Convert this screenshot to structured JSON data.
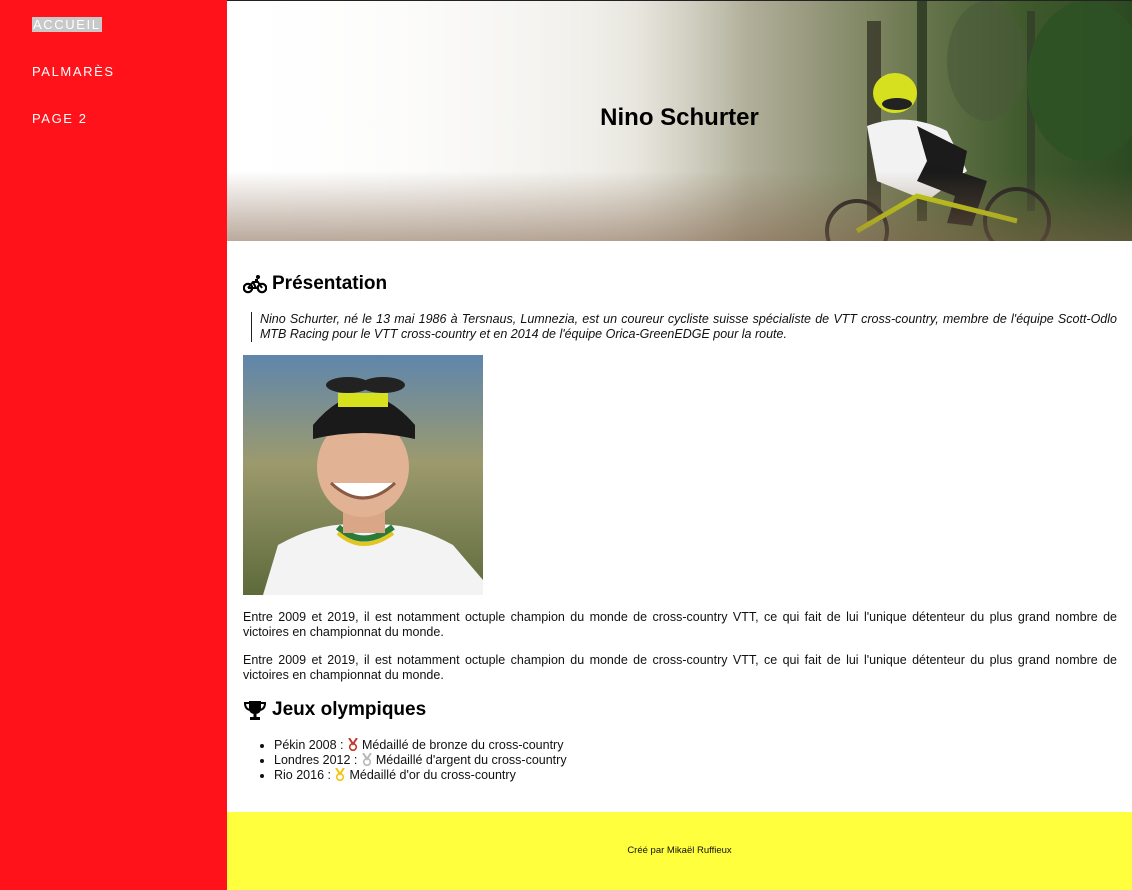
{
  "sidebar": {
    "items": [
      {
        "label": "ACCUEIL",
        "active": true
      },
      {
        "label": "PALMARÈS",
        "active": false
      },
      {
        "label": "PAGE 2",
        "active": false
      }
    ]
  },
  "hero": {
    "title": "Nino Schurter"
  },
  "presentation": {
    "icon": "bicycle-icon",
    "title": "Présentation",
    "quote": "Nino Schurter, né le 13 mai 1986 à Tersnaus, Lumnezia, est un coureur cycliste suisse spécialiste de VTT cross-country, membre de l'équipe Scott-Odlo MTB Racing pour le VTT cross-country et en 2014 de l'équipe Orica-GreenEDGE pour la route.",
    "paragraphs": [
      "Entre 2009 et 2019, il est notamment octuple champion du monde de cross-country VTT, ce qui fait de lui l'unique détenteur du plus grand nombre de victoires en championnat du monde.",
      "Entre 2009 et 2019, il est notamment octuple champion du monde de cross-country VTT, ce qui fait de lui l'unique détenteur du plus grand nombre de victoires en championnat du monde."
    ]
  },
  "olympics": {
    "icon": "trophy-icon",
    "title": "Jeux olympiques",
    "items": [
      {
        "prefix": "Pékin 2008 :",
        "medal": "bronze-medal-icon",
        "text": "Médaillé de bronze du cross-country"
      },
      {
        "prefix": "Londres 2012 :",
        "medal": "silver-medal-icon",
        "text": "Médaillé d'argent du cross-country"
      },
      {
        "prefix": "Rio 2016 :",
        "medal": "gold-medal-icon",
        "text": "Médaillé d'or du cross-country"
      }
    ]
  },
  "footer": {
    "text": "Créé par Mikaël Ruffieux"
  },
  "colors": {
    "sidebar": "#ff121a",
    "footer": "#ffff3d",
    "bronze": "#c0392b",
    "silver": "#b8b8b8",
    "gold": "#f1c40f"
  }
}
